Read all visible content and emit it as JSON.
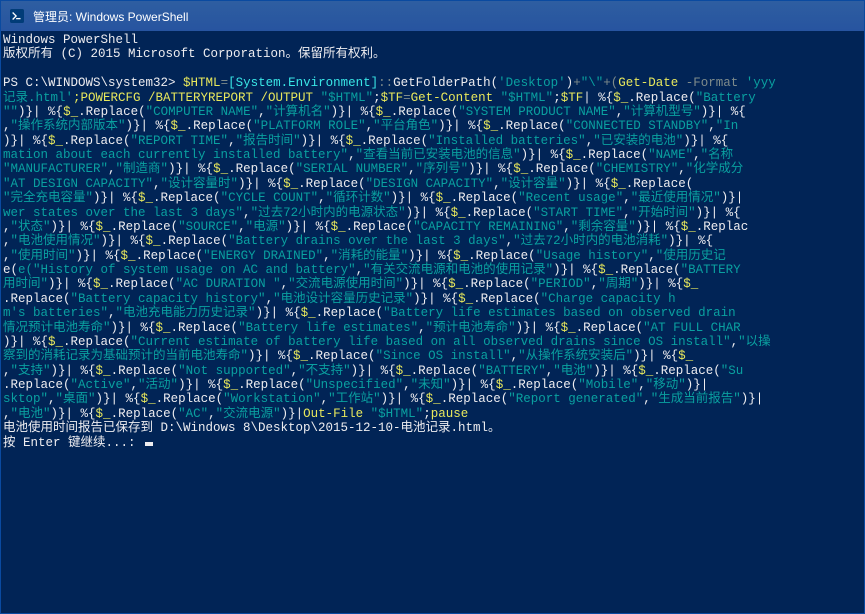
{
  "titlebar": {
    "icon": "powershell-icon",
    "label": "管理员: Windows PowerShell"
  },
  "header": {
    "line1": "Windows PowerShell",
    "line2": "版权所有 (C) 2015 Microsoft Corporation。保留所有权利。"
  },
  "prompt": "PS C:\\WINDOWS\\system32>",
  "cmd": {
    "p01": "$HTML",
    "p02": "=",
    "p03": "[System.Environment]",
    "p04": "::",
    "p05": "GetFolderPath(",
    "p06": "'Desktop'",
    "p07": ")",
    "p08": "+",
    "p09": "\"\\\"",
    "p10": "+(",
    "p11": "Get-Date",
    "p12": "-Format",
    "p13": "'yyy",
    "p14": "记录.html'",
    "p15": ";POWERCFG /BATTERYREPORT /OUTPUT",
    "p16": "\"$HTML\"",
    "p17": ";",
    "p18": "$TF",
    "p19": "=",
    "p20": "Get-Content",
    "p21": "\"$HTML\"",
    "p22": ";",
    "p23": "$TF",
    "p24": "| %{",
    "p25": "$_",
    "p26": ".Replace(",
    "p27": "\"Battery",
    "r01a": "\"\"",
    "r01b": ")}",
    "r01c": "%{",
    "r01d": "$_",
    "r01e": ".Replace(",
    "s01a": "\"COMPUTER NAME\"",
    "s01b": ",",
    "s01c": "\"计算机名\"",
    "r02": ")}| %{",
    "r02b": ".Replace(",
    "s02a": "\"SYSTEM PRODUCT NAME\"",
    "s02c": "\"计算机型号\"",
    "s03a": "\"操作系统内部版本\"",
    "r03c": ".Replace(",
    "s04a": "\"PLATFORM ROLE\"",
    "s04c": "\"平台角色\"",
    "s05a": "\"CONNECTED STANDBY\"",
    "s05c": "\"In",
    "r06d": ".Replace(",
    "s06a": "\"REPORT TIME\"",
    "s06c": "\"报告时间\"",
    "s07a": "\"Installed batteries\"",
    "s07c": "\"已安装的电池\"",
    "s08a": "mation about each currently installed battery\"",
    "s08c": "\"查看当前已安装电池的信息\"",
    "s09a": "\"NAME\"",
    "s09c": "\"名称",
    "s10a": "\"MANUFACTURER\"",
    "s10c": "\"制造商\"",
    "s11a": "\"SERIAL NUMBER\"",
    "s11c": "\"序列号\"",
    "s12a": "\"CHEMISTRY\"",
    "s12c": "\"化学成分",
    "s13a": "\"AT DESIGN CAPACITY\"",
    "s13c": "\"设计容量时\"",
    "s14a": "\"DESIGN CAPACITY\"",
    "s14c": "\"设计容量\"",
    "s15a": "\"完全充电容量\"",
    "s16a": "\"CYCLE COUNT\"",
    "s16c": "\"循环计数\"",
    "s17a": "\"Recent usage\"",
    "s17c": "\"最近使用情况\"",
    "s18a": "wer states over the last 3 days\"",
    "s18c": "\"过去72小时内的电源状态\"",
    "s19a": "\"START TIME\"",
    "s19c": "\"开始时间\"",
    "s20a": "\"状态\"",
    "s21a": "\"SOURCE\"",
    "s21c": "\"电源\"",
    "s22a": "\"CAPACITY REMAINING\"",
    "s22c": "\"剩余容量\"",
    "s23a": "\"电池使用情况\"",
    "s24a": "\"Battery drains over the last 3 days\"",
    "s24c": "\"过去72小时内的电池消耗\"",
    "s25a": "\"使用时间\"",
    "s26a": "\"ENERGY DRAINED\"",
    "s26c": "\"消耗的能量\"",
    "s27a": "\"Usage history\"",
    "s27c": "\"使用历史记",
    "s28a": "e(\"History of system usage on AC and battery\"",
    "s28c": "\"有关交流电源和电池的使用记录\"",
    "s29a": "\"BATTERY",
    "s30a": "用时间\"",
    "s31a": "\"AC DURATION \"",
    "s31c": "\"交流电源使用时间\"",
    "s32a": "\"PERIOD\"",
    "s32c": "\"周期\"",
    "s33a": "\"Battery capacity history\"",
    "s33c": "\"电池设计容量历史记录\"",
    "s34a": "\"Charge capacity h",
    "s35a": "m's batteries\"",
    "s35c": "\"电池充电能力历史记录\"",
    "s36a": "\"Battery life estimates based on observed drain",
    "s37a": "情况预计电池寿命\"",
    "s38a": "\"Battery life estimates\"",
    "s38c": "\"预计电池寿命\"",
    "s39a": "\"AT FULL CHAR",
    "s40a": "\"Current estimate of battery life based on all observed drains since OS install\"",
    "s40c": "\"以操",
    "s41a": "察到的消耗记录为基础预计的当前电池寿命\"",
    "s42a": "\"Since OS install\"",
    "s42c": "\"从操作系统安装后\"",
    "s43a": "\"支持\"",
    "s44a": "\"Not supported\"",
    "s44c": "\"不支持\"",
    "s45a": "\"BATTERY\"",
    "s45c": "\"电池\"",
    "s46a": "\"Su",
    "s47a": "\"Active\"",
    "s47c": "\"活动\"",
    "s48a": "\"Unspecified\"",
    "s48c": "\"未知\"",
    "s49a": "\"Mobile\"",
    "s49c": "\"移动\"",
    "s50a": "sktop\"",
    "s50c": "\"桌面\"",
    "s51a": "\"Workstation\"",
    "s51c": "\"工作站\"",
    "s52a": "\"Report generated\"",
    "s52c": "\"生成当前报告\"",
    "s53a": "\"电池\"",
    "s54a": "\"AC\"",
    "s54c": "\"交流电源\"",
    "outfile": "Out-File",
    "outvar": "\"$HTML\"",
    "pause": "pause"
  },
  "output": {
    "saved": "电池使用时间报告已保存到 D:\\Windows 8\\Desktop\\2015-12-10-电池记录.html。",
    "pause": "按 Enter 键继续...: "
  }
}
